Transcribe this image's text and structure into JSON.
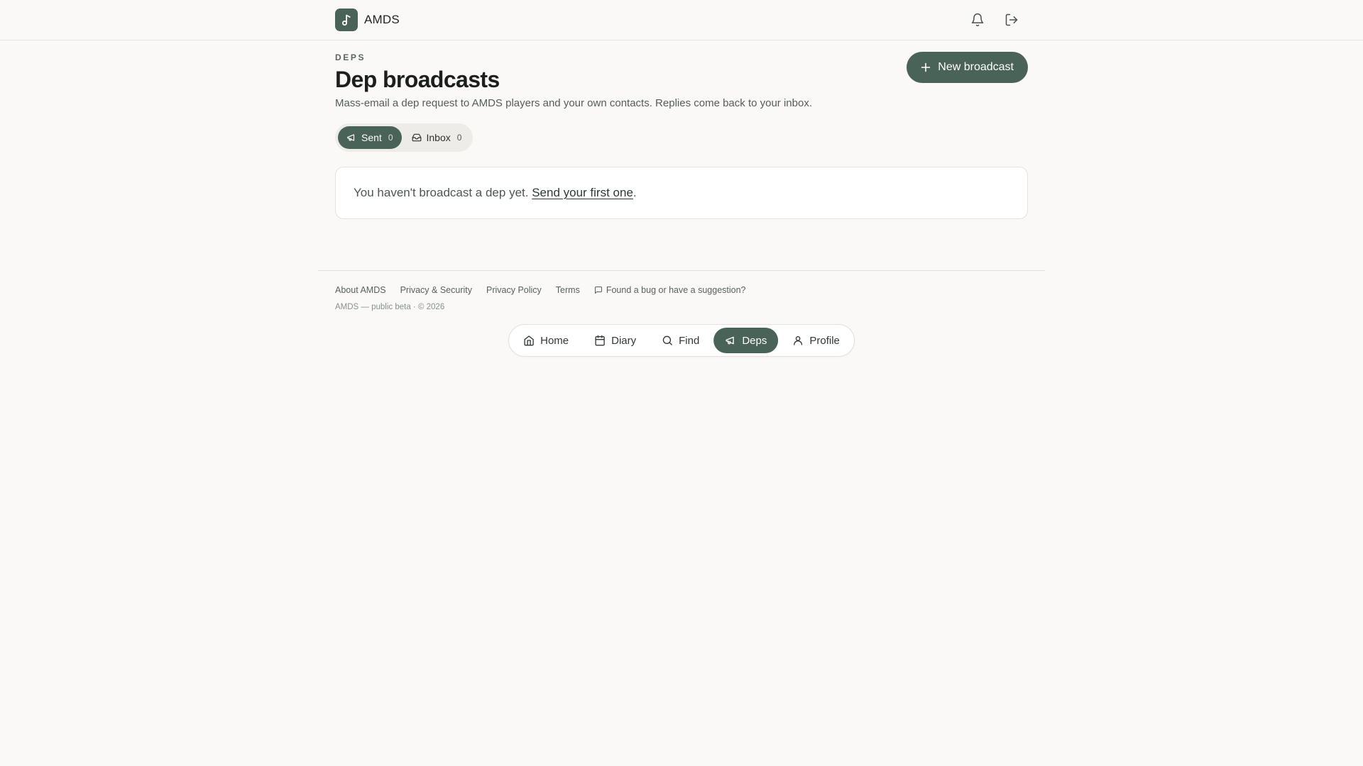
{
  "header": {
    "brand_name": "AMDS",
    "notifications_icon": "bell-icon",
    "logout_icon": "logout-icon"
  },
  "page": {
    "eyebrow": "DEPS",
    "title": "Dep broadcasts",
    "subtitle": "Mass-email a dep request to AMDS players and your own contacts. Replies come back to your inbox.",
    "new_button_label": "New broadcast"
  },
  "tabs": [
    {
      "label": "Sent",
      "count": "0",
      "icon": "megaphone-icon",
      "active": true
    },
    {
      "label": "Inbox",
      "count": "0",
      "icon": "inbox-icon",
      "active": false
    }
  ],
  "empty_state": {
    "text": "You haven't broadcast a dep yet.",
    "link_text": "Send your first one",
    "suffix": "."
  },
  "footer": {
    "links": [
      "About AMDS",
      "Privacy & Security",
      "Privacy Policy",
      "Terms"
    ],
    "feedback": "Found a bug or have a suggestion?",
    "copyright": "AMDS — public beta · © 2026"
  },
  "bottom_nav": [
    {
      "label": "Home",
      "icon": "home-icon",
      "active": false
    },
    {
      "label": "Diary",
      "icon": "calendar-icon",
      "active": false
    },
    {
      "label": "Find",
      "icon": "search-icon",
      "active": false
    },
    {
      "label": "Deps",
      "icon": "megaphone-icon",
      "active": true
    },
    {
      "label": "Profile",
      "icon": "user-icon",
      "active": false
    }
  ],
  "colors": {
    "accent": "#4a6358",
    "background": "#faf9f7",
    "card": "#ffffff",
    "border": "#e4e2de"
  }
}
